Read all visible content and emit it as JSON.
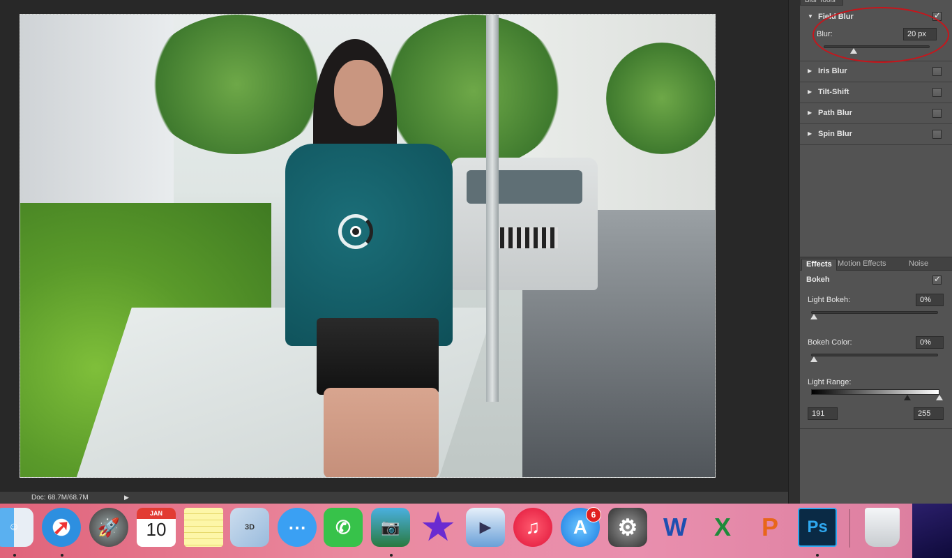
{
  "blur_tools": {
    "panel_tab": "Blur Tools",
    "field_blur": {
      "name": "Field Blur",
      "checked": true,
      "blur_label": "Blur:",
      "blur_value": "20 px",
      "slider_fraction": 0.28
    },
    "items": [
      {
        "name": "Iris Blur",
        "checked": false
      },
      {
        "name": "Tilt-Shift",
        "checked": false
      },
      {
        "name": "Path Blur",
        "checked": false
      },
      {
        "name": "Spin Blur",
        "checked": false
      }
    ]
  },
  "effects": {
    "tabs": [
      "Effects",
      "Motion Effects",
      "Noise"
    ],
    "active_tab": "Effects",
    "bokeh_label": "Bokeh",
    "bokeh_checked": true,
    "light_bokeh": {
      "label": "Light Bokeh:",
      "value": "0%"
    },
    "bokeh_color": {
      "label": "Bokeh Color:",
      "value": "0%"
    },
    "light_range": {
      "label": "Light Range:",
      "low": "191",
      "high": "255"
    }
  },
  "status_bar": {
    "doc_info": "Doc: 68.7M/68.7M",
    "arrow": "▶"
  },
  "annotation_color": "#c8151b",
  "dock": {
    "calendar_month": "JAN",
    "calendar_day": "10",
    "appstore_badge": "6",
    "apps": [
      "finder",
      "safari",
      "launchpad",
      "calendar",
      "notes",
      "preview",
      "messages",
      "facetime",
      "iphoto",
      "imovie",
      "keynote",
      "itunes",
      "app-store",
      "system-preferences",
      "word",
      "excel",
      "powerpoint",
      "photoshop",
      "trash"
    ],
    "photoshop_label": "Ps"
  }
}
